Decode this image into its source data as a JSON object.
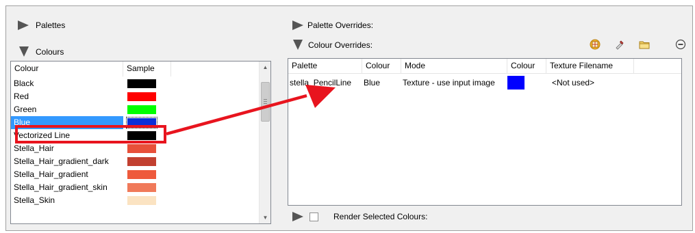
{
  "left": {
    "palettes_label": "Palettes",
    "colours_label": "Colours",
    "list_headers": {
      "colour": "Colour",
      "sample": "Sample"
    },
    "colours": [
      {
        "name": "Black",
        "color": "#000000"
      },
      {
        "name": "Red",
        "color": "#ff0000"
      },
      {
        "name": "Green",
        "color": "#00ff00"
      },
      {
        "name": "Blue",
        "color": "#0a2fd8",
        "selected": true
      },
      {
        "name": "Vectorized Line",
        "color": "#000000"
      },
      {
        "name": "Stella_Hair",
        "color": "#e8503a"
      },
      {
        "name": "Stella_Hair_gradient_dark",
        "color": "#c24030"
      },
      {
        "name": "Stella_Hair_gradient",
        "color": "#ee5a3c"
      },
      {
        "name": "Stella_Hair_gradient_skin",
        "color": "#f07a5a"
      },
      {
        "name": "Stella_Skin",
        "color": "#fbe3c2"
      }
    ]
  },
  "right": {
    "palette_overrides_label": "Palette Overrides:",
    "colour_overrides_label": "Colour Overrides:",
    "toolbar_icons": [
      "palette-grid-icon",
      "eyedropper-icon",
      "folder-icon",
      "remove-icon"
    ],
    "grid_headers": {
      "palette": "Palette",
      "colour": "Colour",
      "mode": "Mode",
      "colour2": "Colour",
      "texture": "Texture Filename"
    },
    "rows": [
      {
        "palette": "stella_PencilLine",
        "colour": "Blue",
        "mode": "Texture - use input image",
        "swatch": "#0000ff",
        "texture": "<Not used>"
      }
    ],
    "render_selected_label": "Render Selected Colours:"
  },
  "annotation": {
    "color": "#e8141e"
  }
}
